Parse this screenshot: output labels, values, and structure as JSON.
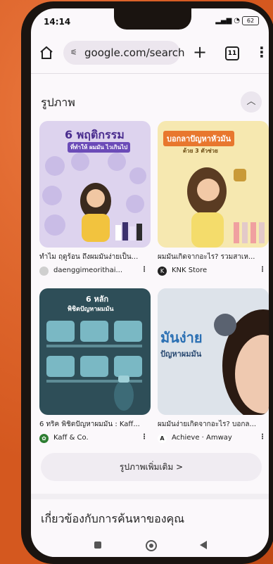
{
  "status": {
    "time": "14:14",
    "battery": "62"
  },
  "browser": {
    "url": "google.com/search",
    "tab_count": "11"
  },
  "images_section": {
    "title": "รูปภาพ",
    "results": [
      {
        "image_title": "6 พฤติกรรม",
        "image_subtitle": "ที่ทำให้ ผมมัน ไวเกินไป",
        "caption": "ทำไม ฤดูร้อน ถึงผมมันง่ายเป็น...",
        "source": "daenggimeorithai..."
      },
      {
        "image_title": "บอกลาปัญหาหัวมัน",
        "image_subtitle": "ด้วย 3 ตัวช่วย",
        "caption": "ผมมันเกิดจากอะไร? รวมสาเห...",
        "source": "KNK Store"
      },
      {
        "image_title": "6 หลัก",
        "image_subtitle": "พิชิตปัญหาผมมัน",
        "caption": "6 ทริค พิชิตปัญหาผมมัน : Kaff...",
        "source": "Kaff & Co."
      },
      {
        "image_title": "มันง่าย",
        "image_subtitle": "ปัญหาผมมัน",
        "caption": "ผมมันง่ายเกิดจากอะไร? บอกล...",
        "source": "Achieve · Amway"
      }
    ],
    "more_label": "รูปภาพเพิ่มเติม  >"
  },
  "related_title": "เกี่ยวข้องกับการค้นหาของคุณ",
  "colors": {
    "accent_orange": "#d4581f",
    "card_purple": "#ddd3ee",
    "card_yellow": "#f6e8b0",
    "card_teal": "#2e4e58"
  }
}
